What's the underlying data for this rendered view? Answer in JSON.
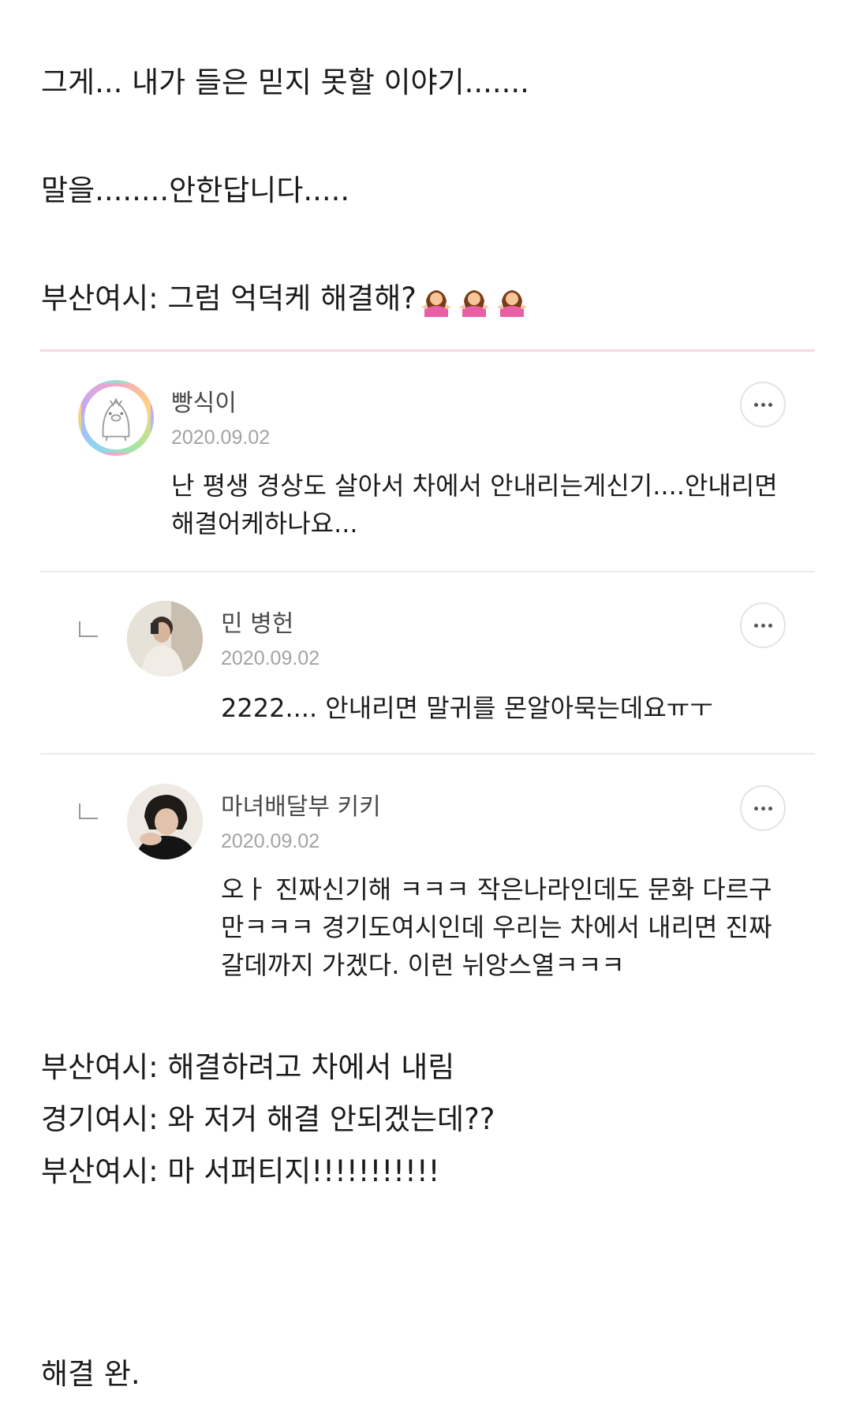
{
  "story": {
    "line1": "그게... 내가 들은 믿지 못할 이야기.......",
    "line2": "말을........안한답니다.....",
    "line3": "부산여시: 그럼 억덕케 해결해?",
    "line3_emoji": "person-shrugging",
    "line4": "부산여시: 해결하려고 차에서 내림",
    "line5": "경기여시: 와 저거 해결 안되겠는데??",
    "line6": "부산여시: 마 서퍼티지!!!!!!!!!!!",
    "line7": "해결 완."
  },
  "comments": [
    {
      "author": "빵식이",
      "date": "2020.09.02",
      "text": "난 평생 경상도 살아서 차에서 안내리는게신기....안내리면 해결어케하나요...",
      "is_reply": false
    },
    {
      "author": "민 병헌",
      "date": "2020.09.02",
      "text": "2222.... 안내리면 말귀를 몬알아묵는데요ㅠㅜ",
      "is_reply": true
    },
    {
      "author": "마녀배달부 키키",
      "date": "2020.09.02",
      "text": "오ㅏ 진짜신기해 ㅋㅋㅋ 작은나라인데도 문화 다르구만ㅋㅋㅋ 경기도여시인데 우리는 차에서 내리면 진짜 갈데까지 가겠다. 이런 뉘앙스열ㅋㅋㅋ",
      "is_reply": true
    }
  ],
  "colors": {
    "accent_rule": "#f6d9de",
    "divider": "#ececec",
    "date_gray": "#a3a3a3"
  }
}
